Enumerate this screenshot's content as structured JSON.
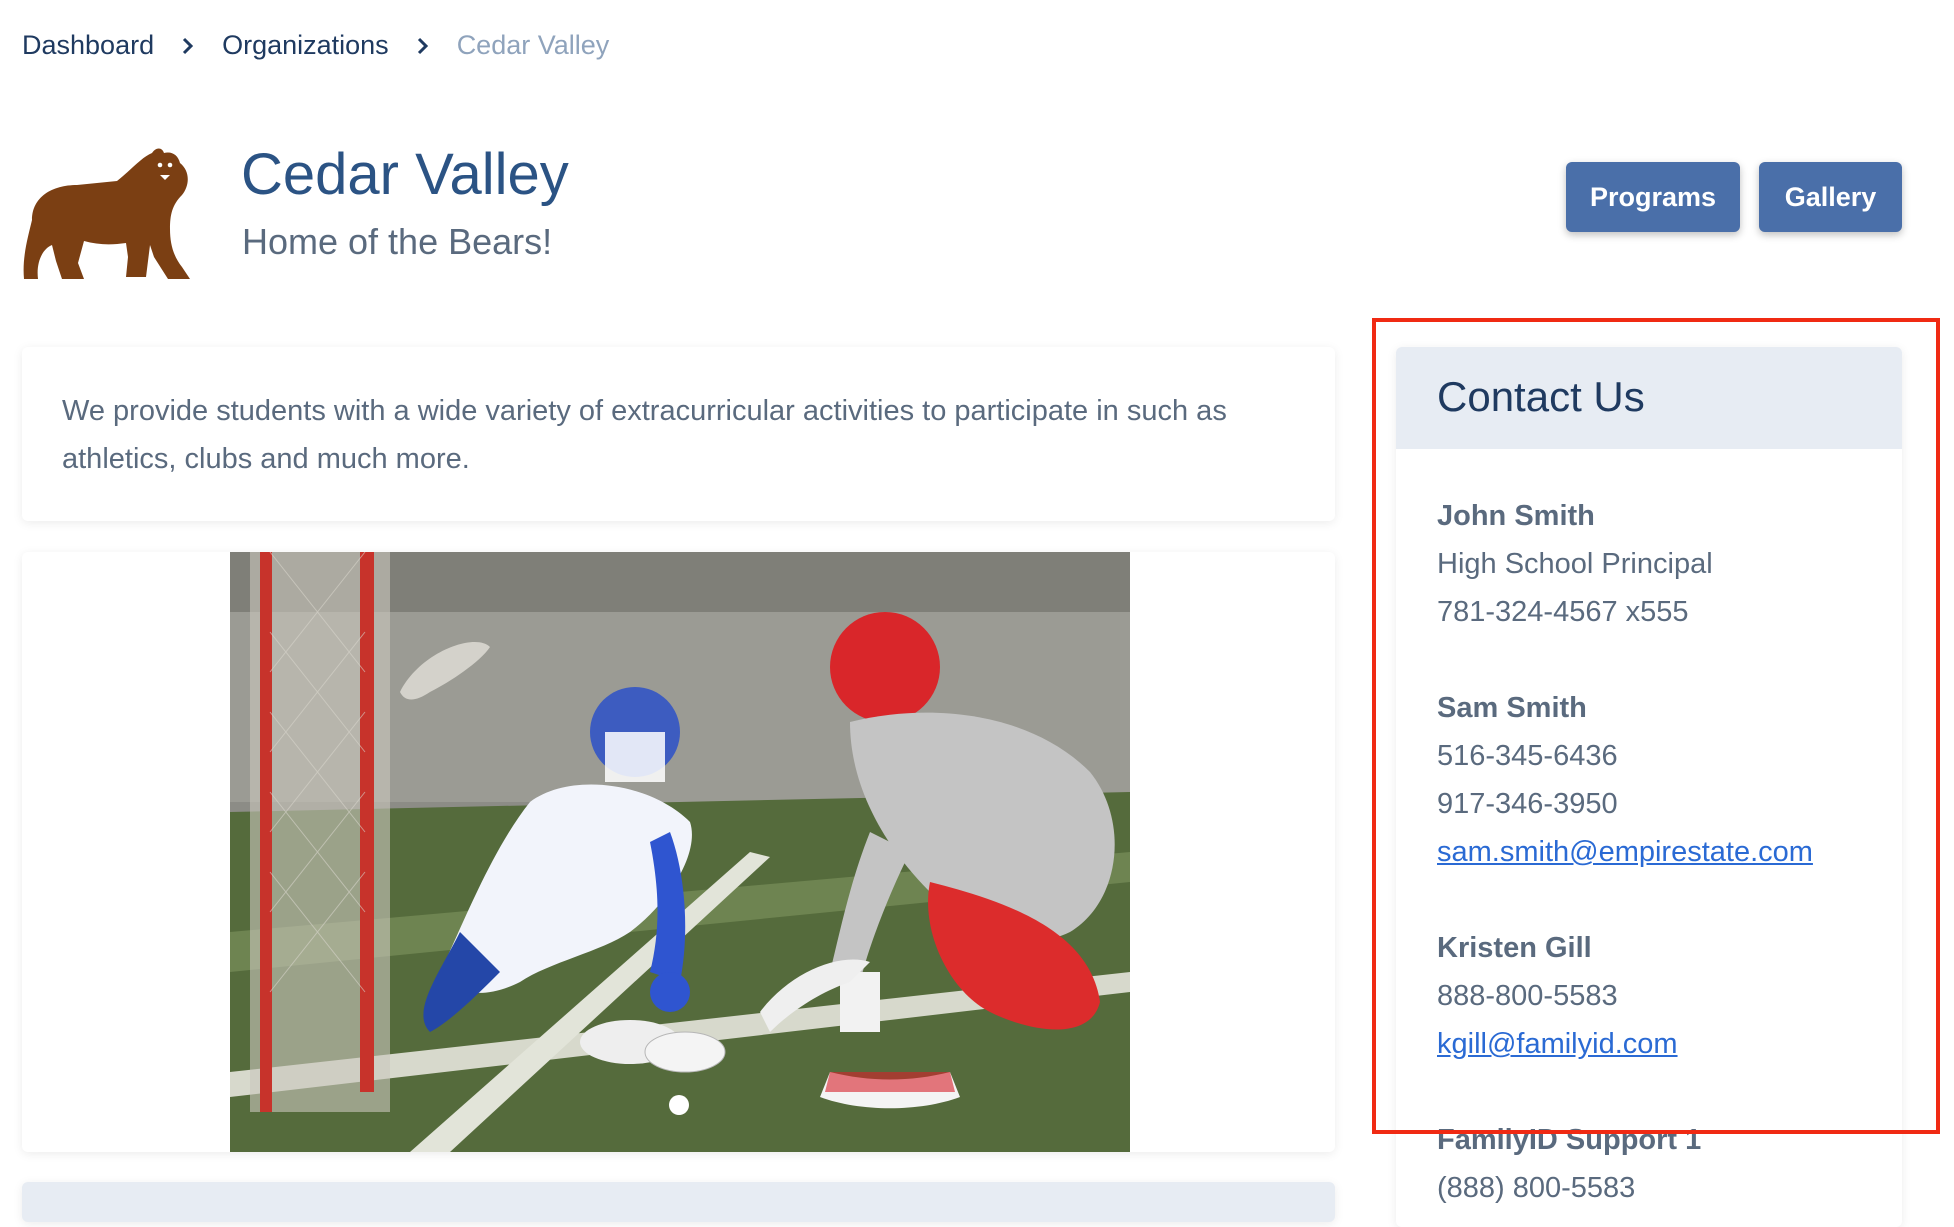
{
  "breadcrumb": {
    "items": [
      "Dashboard",
      "Organizations",
      "Cedar Valley"
    ]
  },
  "organization": {
    "name": "Cedar Valley",
    "tagline": "Home of the Bears!",
    "logo_icon": "bear-icon",
    "description": "We provide students with a wide variety of extracurricular activities to participate in such as athletics, clubs and much more."
  },
  "actions": {
    "programs_label": "Programs",
    "gallery_label": "Gallery"
  },
  "carousel": {
    "active_index": 0,
    "slide_count": 1
  },
  "contact": {
    "title": "Contact Us",
    "people": [
      {
        "name": "John Smith",
        "title": "High School Principal",
        "phone": "781-324-4567 x555"
      },
      {
        "name": "Sam Smith",
        "phone": "516-345-6436",
        "phone2": "917-346-3950",
        "email": "sam.smith@empirestate.com"
      },
      {
        "name": "Kristen Gill",
        "phone": "888-800-5583",
        "email": "kgill@familyid.com"
      },
      {
        "name": "FamilyID Support 1",
        "phone": "(888) 800-5583"
      }
    ]
  },
  "colors": {
    "primary_button": "#4a6fa9",
    "heading": "#2b5384",
    "link": "#2a6ad4",
    "highlight_box": "#f02a13",
    "panel_header": "#e7ecf3",
    "bear": "#7b3f13"
  }
}
